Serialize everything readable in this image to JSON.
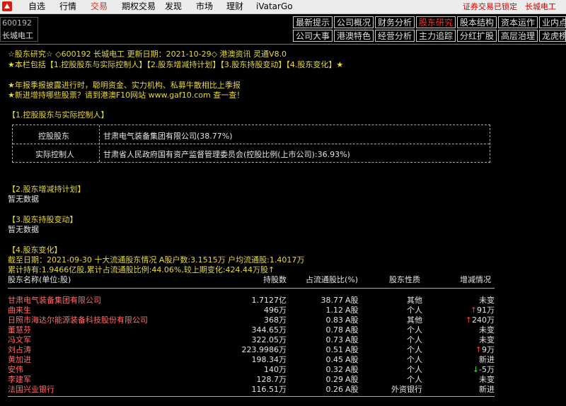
{
  "menu": {
    "items": [
      "自选",
      "行情",
      "交易",
      "期权交易",
      "发现",
      "市场",
      "理财",
      "iVatarGo"
    ],
    "active_index": 2,
    "lock_message": "证券交易已锁定",
    "stock_name_right": "长城电工"
  },
  "stock": {
    "code": "600192",
    "name": "长城电工"
  },
  "tabs_row1": [
    "最新提示",
    "公司概况",
    "财务分析",
    "股东研究",
    "股本结构",
    "资本运作",
    "业内点评"
  ],
  "tabs_row2": [
    "公司大事",
    "港澳特色",
    "经营分析",
    "主力追踪",
    "分红扩股",
    "高层治理",
    "龙虎榜单"
  ],
  "active_tab": "股东研究",
  "header": {
    "line1": "☆股东研究☆ ◇600192 长城电工 更新日期：2021-10-29◇ 港澳资讯 灵通V8.0",
    "line2": "★本栏包括【1.控股股东与实际控制人】【2.股东增减持计划】【3.股东持股变动】【4.股东变化】★",
    "line3": "★年报季报披露进行时，聪明资金、实力机构、私募牛散相比上季报",
    "line4": "★新进增持哪些股票？请到港澳F10网站 www.gaf10.com 查一查！"
  },
  "section1": {
    "title": "【1.控股股东与实际控制人】",
    "rows": [
      {
        "label": "控股股东",
        "value": "甘肃电气装备集团有限公司(38.77%)"
      },
      {
        "label": "实际控制人",
        "value": "甘肃省人民政府国有资产监督管理委员会(控股比例(上市公司):36.93%)"
      }
    ]
  },
  "section2": {
    "title": "【2.股东增减持计划】",
    "body": "暂无数据"
  },
  "section3": {
    "title": "【3.股东持股变动】",
    "body": "暂无数据"
  },
  "section4": {
    "title": "【4.股东变化】",
    "summary1": "截至日期：2021-09-30 十大流通股东情况 A股户数:3.1515万 户均流通股:1.4017万",
    "summary2": "累计持有:1.9466亿股,累计占流通股比例:44.06%,较上期变化:424.44万股↑",
    "columns": [
      "股东名称(单位:股)",
      "持股数",
      "占流通股比(%)",
      "股东性质",
      "增减情况"
    ],
    "rows": [
      {
        "name": "甘肃电气装备集团有限公司",
        "hold": "1.7127亿",
        "pct": "38.77",
        "unit": "A股",
        "nature": "其他",
        "change": "未变",
        "arrow": ""
      },
      {
        "name": "曲来生",
        "hold": "496万",
        "pct": "1.12",
        "unit": "A股",
        "nature": "个人",
        "change": "91万",
        "arrow": "up"
      },
      {
        "name": "日照市海达尔能源装备科技股份有限公司",
        "hold": "368万",
        "pct": "0.83",
        "unit": "A股",
        "nature": "其他",
        "change": "240万",
        "arrow": "up"
      },
      {
        "name": "董慧芬",
        "hold": "344.65万",
        "pct": "0.78",
        "unit": "A股",
        "nature": "个人",
        "change": "未变",
        "arrow": ""
      },
      {
        "name": "冯文军",
        "hold": "322.05万",
        "pct": "0.73",
        "unit": "A股",
        "nature": "个人",
        "change": "未变",
        "arrow": ""
      },
      {
        "name": "刘占涛",
        "hold": "223.9986万",
        "pct": "0.51",
        "unit": "A股",
        "nature": "个人",
        "change": "9万",
        "arrow": "up"
      },
      {
        "name": "黄加进",
        "hold": "198.34万",
        "pct": "0.45",
        "unit": "A股",
        "nature": "个人",
        "change": "新进",
        "arrow": ""
      },
      {
        "name": "安伟",
        "hold": "140万",
        "pct": "0.32",
        "unit": "A股",
        "nature": "个人",
        "change": "-5万",
        "arrow": "down"
      },
      {
        "name": "李建军",
        "hold": "128.7万",
        "pct": "0.29",
        "unit": "A股",
        "nature": "个人",
        "change": "未变",
        "arrow": ""
      },
      {
        "name": "法国兴业银行",
        "hold": "116.51万",
        "pct": "0.26",
        "unit": "A股",
        "nature": "外资银行",
        "change": "新进",
        "arrow": ""
      }
    ]
  },
  "colors": {
    "accent_red": "#e03020",
    "name_red": "#ff6b6b",
    "heading_yellow": "#e8d840"
  }
}
